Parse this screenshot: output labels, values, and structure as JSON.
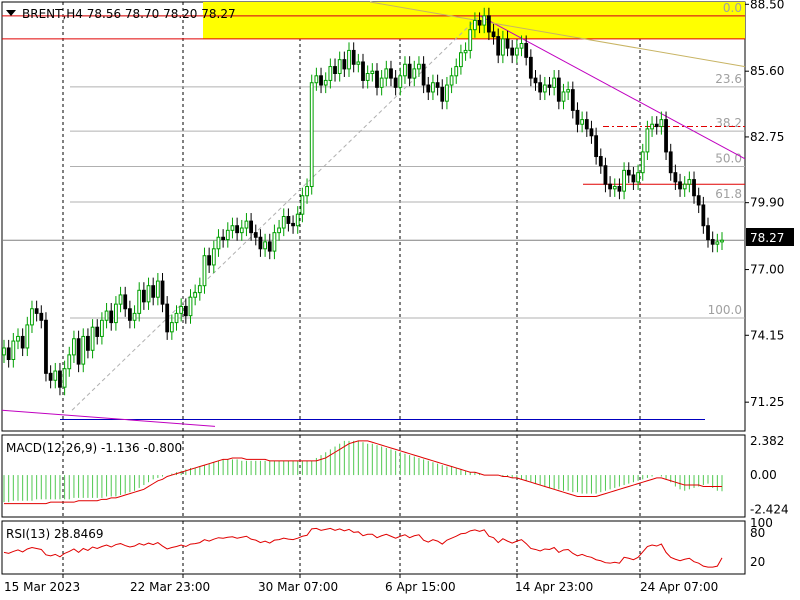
{
  "symbol_header": "BRENT,H4  78.56 78.70 78.20 78.27",
  "macd_label": "MACD(12,26,9) -1.136 -0.800",
  "rsi_label": "RSI(13) 28.8469",
  "current_price": "78.27",
  "colors": {
    "up_candle": "#00a000",
    "down_candle": "#000000",
    "macd_histogram": "#50c850",
    "macd_signal": "#e00000",
    "rsi_line": "#e00000",
    "fib_label": "#a0a0a0",
    "highlight_band": "#ffff00",
    "resistance_line": "#e00000",
    "trend_line": "#c000c0",
    "support_line": "#0000c0",
    "fan_line": "#c8b464"
  },
  "chart_data": {
    "type": "candlestick",
    "timeframe": "H4",
    "x_ticks": [
      "15 Mar 2023",
      "22 Mar 23:00",
      "30 Mar 07:00",
      "6 Apr 15:00",
      "14 Apr 23:00",
      "24 Apr 07:00"
    ],
    "price_axis": {
      "ticks": [
        "88.50",
        "85.60",
        "82.75",
        "79.90",
        "77.00",
        "74.15",
        "71.25"
      ],
      "range": [
        70.0,
        88.6
      ]
    },
    "fibonacci_levels": [
      {
        "label": "0.0",
        "price": 88.0
      },
      {
        "label": "23.6",
        "price": 84.92
      },
      {
        "label": "38.2",
        "price": 83.0
      },
      {
        "label": "50.0",
        "price": 81.47
      },
      {
        "label": "61.8",
        "price": 79.93
      },
      {
        "label": "100.0",
        "price": 74.9
      }
    ],
    "close": [
      73.6,
      73.1,
      73.9,
      74.1,
      73.6,
      74.6,
      75.3,
      75.1,
      74.8,
      72.5,
      72.2,
      72.6,
      71.9,
      72.7,
      73.3,
      74.0,
      72.9,
      74.1,
      73.5,
      74.5,
      74.1,
      74.8,
      75.2,
      74.7,
      75.5,
      75.9,
      75.3,
      74.8,
      75.1,
      76.1,
      75.6,
      76.3,
      75.8,
      76.5,
      75.5,
      74.3,
      74.7,
      75.1,
      75.4,
      75.0,
      75.8,
      76.0,
      76.3,
      77.6,
      77.2,
      77.9,
      78.4,
      78.3,
      78.7,
      78.9,
      78.6,
      78.8,
      79.1,
      78.6,
      78.4,
      77.9,
      78.2,
      77.8,
      78.6,
      78.8,
      79.3,
      79.0,
      78.9,
      79.4,
      80.2,
      80.6,
      85.1,
      85.4,
      85.0,
      85.2,
      85.8,
      85.5,
      86.1,
      85.7,
      86.5,
      85.9,
      86.0,
      85.2,
      85.5,
      85.6,
      84.9,
      85.3,
      85.7,
      85.3,
      84.9,
      85.4,
      85.9,
      85.3,
      85.7,
      85.9,
      85.0,
      84.7,
      85.1,
      84.9,
      84.3,
      85.0,
      85.4,
      85.8,
      86.4,
      86.5,
      87.4,
      87.8,
      87.6,
      88.0,
      87.3,
      87.1,
      86.3,
      87.0,
      86.6,
      86.3,
      86.6,
      86.8,
      86.2,
      85.3,
      85.1,
      84.7,
      85.0,
      84.9,
      85.3,
      84.3,
      84.7,
      84.8,
      83.9,
      83.3,
      83.5,
      83.1,
      82.8,
      81.9,
      81.5,
      80.7,
      80.5,
      80.6,
      80.4,
      81.3,
      81.1,
      80.8,
      81.2,
      82.1,
      83.1,
      83.3,
      83.2,
      83.5,
      82.1,
      81.2,
      80.8,
      80.5,
      80.7,
      80.9,
      80.2,
      79.8,
      78.9,
      78.3,
      78.1,
      78.2,
      78.27
    ],
    "fan_line": {
      "start": {
        "index": 68,
        "price": 74.8
      },
      "end": {
        "index": 102,
        "price": 88.0
      }
    },
    "macd": {
      "y_ticks": [
        "2.382",
        "0.00",
        "-2.424"
      ],
      "y_range": [
        -2.8,
        2.6
      ],
      "histogram": [
        -1.9,
        -1.9,
        -1.8,
        -1.8,
        -1.8,
        -1.8,
        -1.8,
        -1.7,
        -1.7,
        -1.7,
        -1.7,
        -1.7,
        -1.7,
        -1.7,
        -1.7,
        -1.6,
        -1.6,
        -1.6,
        -1.6,
        -1.6,
        -1.6,
        -1.6,
        -1.5,
        -1.5,
        -1.5,
        -1.4,
        -1.3,
        -1.2,
        -1.1,
        -0.9,
        -0.7,
        -0.5,
        -0.3,
        -0.2,
        -0.1,
        0.0,
        0.1,
        0.2,
        0.3,
        0.4,
        0.5,
        0.5,
        0.6,
        0.7,
        0.8,
        0.9,
        1.0,
        1.1,
        1.1,
        1.1,
        1.1,
        1.0,
        1.0,
        1.0,
        1.0,
        1.0,
        1.0,
        1.0,
        1.0,
        1.0,
        1.0,
        1.0,
        1.0,
        1.0,
        1.0,
        1.0,
        1.0,
        1.2,
        1.4,
        1.6,
        1.8,
        2.0,
        2.2,
        2.4,
        2.4,
        2.4,
        2.4,
        2.3,
        2.2,
        2.2,
        2.1,
        2.0,
        1.9,
        1.8,
        1.7,
        1.6,
        1.5,
        1.4,
        1.3,
        1.2,
        1.1,
        1.0,
        0.9,
        0.8,
        0.7,
        0.6,
        0.6,
        0.5,
        0.4,
        0.3,
        0.2,
        0.2,
        0.1,
        0.0,
        0.0,
        0.0,
        0.0,
        -0.1,
        -0.1,
        -0.2,
        -0.2,
        -0.3,
        -0.4,
        -0.5,
        -0.6,
        -0.7,
        -0.8,
        -0.9,
        -1.0,
        -1.0,
        -1.1,
        -1.1,
        -1.2,
        -1.2,
        -1.3,
        -1.3,
        -1.3,
        -1.3,
        -1.2,
        -1.1,
        -1.0,
        -0.9,
        -0.8,
        -0.7,
        -0.6,
        -0.5,
        -0.4,
        -0.3,
        -0.2,
        -0.1,
        0.0,
        -0.1,
        -0.3,
        -0.5,
        -0.8,
        -1.0,
        -1.1,
        -1.0,
        -0.9,
        -0.8,
        -0.7,
        -0.6,
        -0.9,
        -1.1,
        -1.136
      ],
      "signal": [
        -2.0,
        -2.0,
        -2.0,
        -2.0,
        -2.0,
        -2.0,
        -2.0,
        -2.0,
        -2.0,
        -2.0,
        -1.9,
        -1.9,
        -1.9,
        -1.9,
        -1.9,
        -1.9,
        -1.8,
        -1.8,
        -1.8,
        -1.8,
        -1.8,
        -1.7,
        -1.7,
        -1.6,
        -1.6,
        -1.5,
        -1.4,
        -1.3,
        -1.2,
        -1.1,
        -1.0,
        -0.8,
        -0.6,
        -0.4,
        -0.3,
        -0.1,
        0.0,
        0.1,
        0.2,
        0.3,
        0.4,
        0.5,
        0.6,
        0.7,
        0.8,
        0.9,
        1.0,
        1.1,
        1.1,
        1.2,
        1.2,
        1.2,
        1.1,
        1.1,
        1.1,
        1.1,
        1.1,
        1.0,
        1.0,
        1.0,
        1.0,
        1.0,
        1.0,
        1.0,
        1.0,
        1.0,
        1.0,
        1.0,
        1.1,
        1.2,
        1.4,
        1.6,
        1.8,
        2.0,
        2.2,
        2.3,
        2.4,
        2.4,
        2.4,
        2.3,
        2.2,
        2.1,
        2.0,
        1.9,
        1.8,
        1.7,
        1.6,
        1.5,
        1.4,
        1.3,
        1.2,
        1.1,
        1.0,
        0.9,
        0.8,
        0.7,
        0.6,
        0.5,
        0.4,
        0.3,
        0.2,
        0.2,
        0.1,
        0.0,
        0.0,
        0.0,
        0.0,
        -0.1,
        -0.1,
        -0.2,
        -0.2,
        -0.3,
        -0.4,
        -0.5,
        -0.6,
        -0.7,
        -0.8,
        -0.9,
        -1.0,
        -1.1,
        -1.2,
        -1.3,
        -1.4,
        -1.5,
        -1.5,
        -1.5,
        -1.5,
        -1.5,
        -1.4,
        -1.3,
        -1.2,
        -1.1,
        -1.0,
        -0.9,
        -0.8,
        -0.7,
        -0.6,
        -0.5,
        -0.4,
        -0.3,
        -0.2,
        -0.2,
        -0.3,
        -0.4,
        -0.5,
        -0.6,
        -0.7,
        -0.7,
        -0.7,
        -0.7,
        -0.8,
        -0.8,
        -0.8,
        -0.8,
        -0.8
      ]
    },
    "rsi": {
      "y_ticks": [
        "100",
        "80",
        "20"
      ],
      "y_range": [
        0,
        100
      ],
      "values": [
        40,
        38,
        42,
        45,
        41,
        47,
        50,
        48,
        46,
        35,
        33,
        36,
        31,
        38,
        42,
        47,
        40,
        48,
        44,
        51,
        48,
        52,
        55,
        51,
        56,
        58,
        54,
        51,
        53,
        58,
        55,
        59,
        56,
        60,
        53,
        47,
        50,
        52,
        55,
        52,
        57,
        58,
        60,
        66,
        63,
        67,
        70,
        69,
        71,
        72,
        69,
        71,
        73,
        67,
        65,
        60,
        63,
        59,
        65,
        66,
        69,
        67,
        66,
        69,
        73,
        75,
        88,
        89,
        85,
        87,
        89,
        85,
        88,
        84,
        87,
        81,
        82,
        74,
        77,
        77,
        70,
        74,
        77,
        73,
        69,
        73,
        76,
        70,
        74,
        76,
        65,
        61,
        66,
        63,
        57,
        65,
        69,
        73,
        78,
        79,
        84,
        86,
        83,
        86,
        73,
        70,
        60,
        68,
        63,
        59,
        63,
        66,
        58,
        48,
        46,
        43,
        47,
        46,
        50,
        40,
        45,
        46,
        38,
        33,
        36,
        32,
        30,
        25,
        23,
        19,
        18,
        20,
        18,
        30,
        28,
        25,
        30,
        41,
        52,
        55,
        53,
        57,
        40,
        30,
        26,
        23,
        26,
        28,
        21,
        18,
        12,
        10,
        10,
        12,
        28.85
      ]
    }
  }
}
